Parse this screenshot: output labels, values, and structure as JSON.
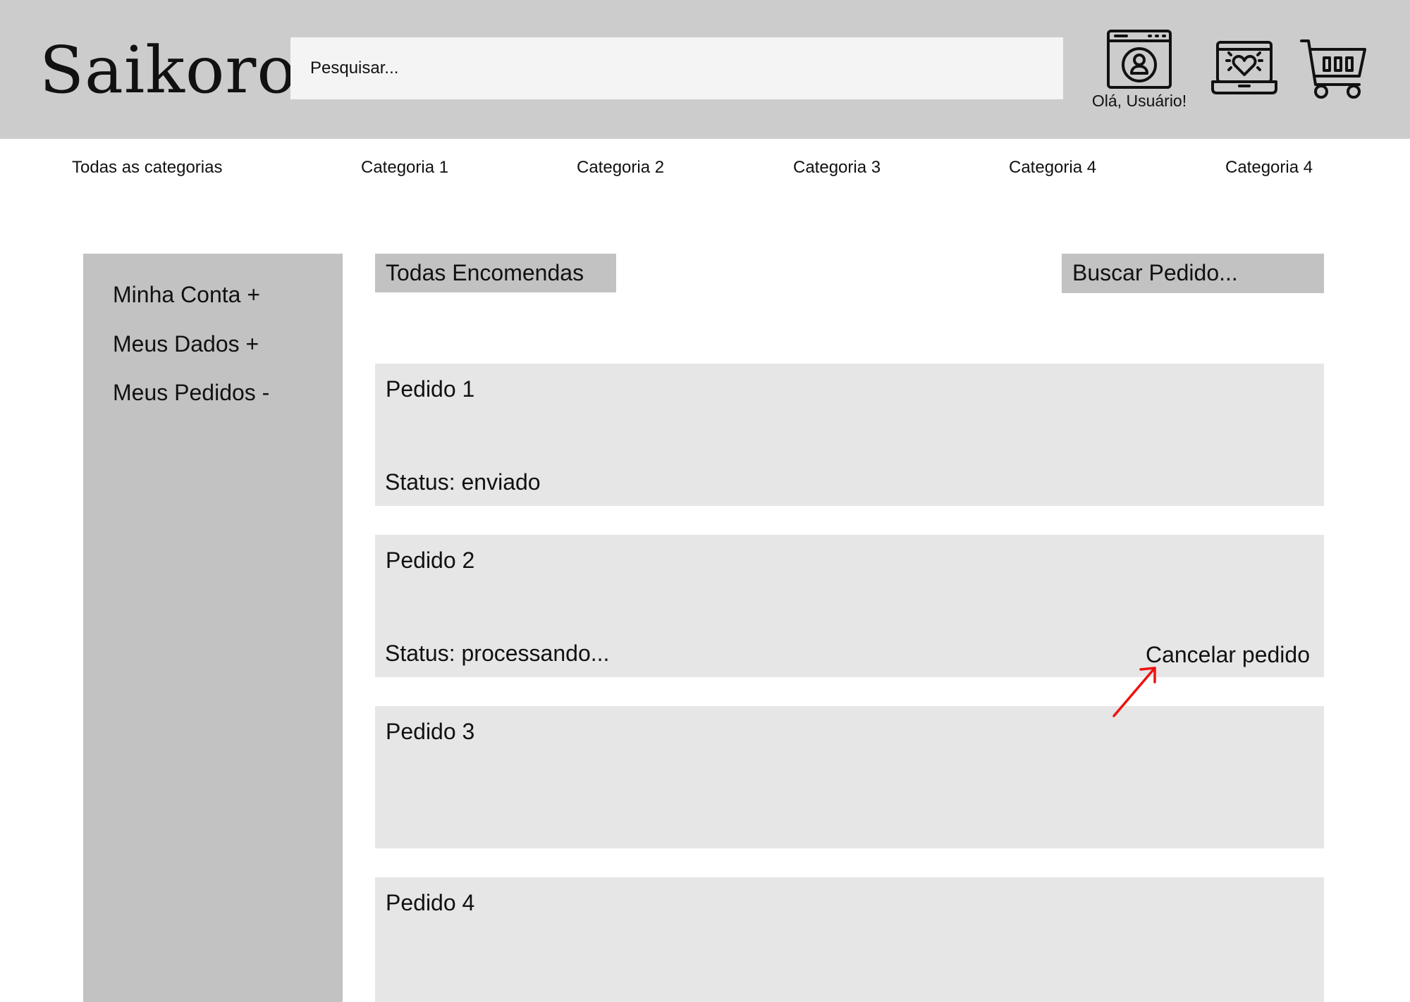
{
  "header": {
    "logo": "Saikoro",
    "search": {
      "placeholder": "Pesquisar..."
    },
    "account": {
      "icon": "user-account-icon",
      "greeting": "Olá, Usuário!"
    },
    "wishlist": {
      "icon": "heart-laptop-icon"
    },
    "cart": {
      "icon": "shopping-cart-icon"
    }
  },
  "categories": [
    {
      "label": "Todas as categorias"
    },
    {
      "label": "Categoria 1"
    },
    {
      "label": "Categoria 2"
    },
    {
      "label": "Categoria 3"
    },
    {
      "label": "Categoria 4"
    },
    {
      "label": "Categoria 4"
    }
  ],
  "sidebar": {
    "items": [
      {
        "label": "Minha Conta +"
      },
      {
        "label": "Meus Dados +"
      },
      {
        "label": "Meus Pedidos -"
      }
    ]
  },
  "main": {
    "title": "Todas Encomendas",
    "order_search": "Buscar Pedido...",
    "orders": [
      {
        "title": "Pedido 1",
        "status": "Status: enviado"
      },
      {
        "title": "Pedido 2",
        "status": "Status: processando...",
        "action": "Cancelar pedido"
      },
      {
        "title": "Pedido 3"
      },
      {
        "title": "Pedido 4"
      }
    ]
  },
  "colors": {
    "header_bg": "#cccccc",
    "search_bg": "#f4f4f4",
    "sidebar_bg": "#c2c2c2",
    "card_bg": "#e6e6e6",
    "annotation_arrow": "#ee1111"
  }
}
